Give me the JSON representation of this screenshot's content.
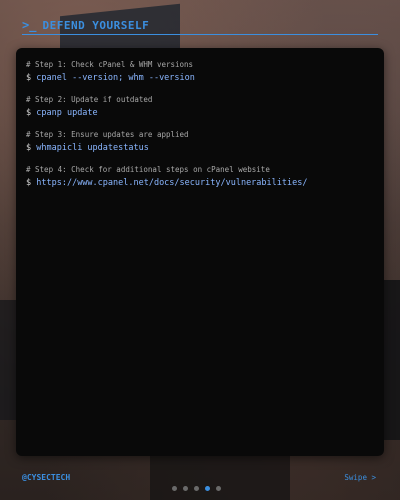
{
  "header": {
    "prompt_symbol": ">_",
    "title": "DEFEND YOURSELF"
  },
  "terminal": {
    "prompt": "$",
    "steps": [
      {
        "comment": "# Step 1: Check cPanel & WHM versions",
        "command": "cpanel --version; whm --version"
      },
      {
        "comment": "# Step 2: Update if outdated",
        "command": "cpanp update"
      },
      {
        "comment": "# Step 3: Ensure updates are applied",
        "command": "whmapicli updatestatus"
      },
      {
        "comment": "# Step 4: Check for additional steps on cPanel website",
        "command": "https://www.cpanel.net/docs/security/vulnerabilities/"
      }
    ]
  },
  "footer": {
    "handle": "@CYSECTECH",
    "swipe_label": "Swipe >"
  },
  "pagination": {
    "total": 5,
    "active_index": 3
  },
  "colors": {
    "accent": "#3b8fe0",
    "command": "#8ab6ff",
    "comment": "#a8a8a8",
    "terminal_bg": "#090909"
  }
}
